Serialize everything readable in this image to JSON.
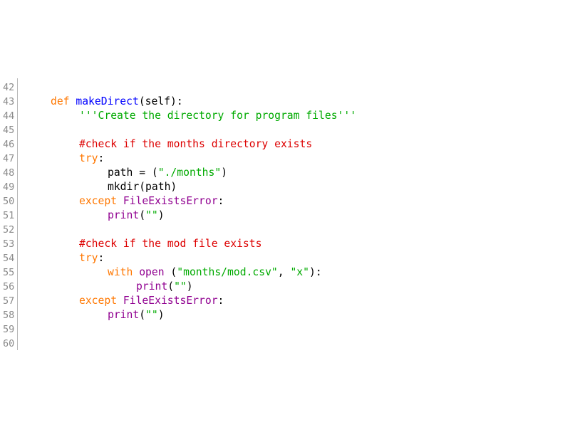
{
  "colors": {
    "keyword": "#ff7700",
    "definition": "#0000ff",
    "string": "#00aa00",
    "comment": "#dd0000",
    "builtin": "#900090",
    "plain": "#000000",
    "line_number": "#8a8a8a"
  },
  "lines": [
    {
      "n": "42",
      "indent": 0,
      "tokens": []
    },
    {
      "n": "43",
      "indent": 0,
      "tokens": [
        {
          "t": "def",
          "c": "keyword"
        },
        {
          "t": " ",
          "c": "plain"
        },
        {
          "t": "makeDirect",
          "c": "definition"
        },
        {
          "t": "(self):",
          "c": "plain"
        }
      ]
    },
    {
      "n": "44",
      "indent": 1,
      "tokens": [
        {
          "t": "'''Create the directory for program files'''",
          "c": "string"
        }
      ]
    },
    {
      "n": "45",
      "indent": 0,
      "tokens": []
    },
    {
      "n": "46",
      "indent": 1,
      "tokens": [
        {
          "t": "#check if the months directory exists",
          "c": "comment"
        }
      ]
    },
    {
      "n": "47",
      "indent": 1,
      "tokens": [
        {
          "t": "try",
          "c": "keyword"
        },
        {
          "t": ":",
          "c": "plain"
        }
      ]
    },
    {
      "n": "48",
      "indent": 2,
      "tokens": [
        {
          "t": "path = (",
          "c": "plain"
        },
        {
          "t": "\"./months\"",
          "c": "string"
        },
        {
          "t": ")",
          "c": "plain"
        }
      ]
    },
    {
      "n": "49",
      "indent": 2,
      "tokens": [
        {
          "t": "mkdir(path)",
          "c": "plain"
        }
      ]
    },
    {
      "n": "50",
      "indent": 1,
      "tokens": [
        {
          "t": "except",
          "c": "keyword"
        },
        {
          "t": " ",
          "c": "plain"
        },
        {
          "t": "FileExistsError",
          "c": "builtin"
        },
        {
          "t": ":",
          "c": "plain"
        }
      ]
    },
    {
      "n": "51",
      "indent": 2,
      "tokens": [
        {
          "t": "print",
          "c": "builtin"
        },
        {
          "t": "(",
          "c": "plain"
        },
        {
          "t": "\"\"",
          "c": "string"
        },
        {
          "t": ")",
          "c": "plain"
        }
      ]
    },
    {
      "n": "52",
      "indent": 0,
      "tokens": []
    },
    {
      "n": "53",
      "indent": 1,
      "tokens": [
        {
          "t": "#check if the mod file exists",
          "c": "comment"
        }
      ]
    },
    {
      "n": "54",
      "indent": 1,
      "tokens": [
        {
          "t": "try",
          "c": "keyword"
        },
        {
          "t": ":",
          "c": "plain"
        }
      ]
    },
    {
      "n": "55",
      "indent": 2,
      "tokens": [
        {
          "t": "with",
          "c": "keyword"
        },
        {
          "t": " ",
          "c": "plain"
        },
        {
          "t": "open",
          "c": "builtin"
        },
        {
          "t": " (",
          "c": "plain"
        },
        {
          "t": "\"months/mod.csv\"",
          "c": "string"
        },
        {
          "t": ", ",
          "c": "plain"
        },
        {
          "t": "\"x\"",
          "c": "string"
        },
        {
          "t": "):",
          "c": "plain"
        }
      ]
    },
    {
      "n": "56",
      "indent": 3,
      "tokens": [
        {
          "t": "print",
          "c": "builtin"
        },
        {
          "t": "(",
          "c": "plain"
        },
        {
          "t": "\"\"",
          "c": "string"
        },
        {
          "t": ")",
          "c": "plain"
        }
      ]
    },
    {
      "n": "57",
      "indent": 1,
      "tokens": [
        {
          "t": "except",
          "c": "keyword"
        },
        {
          "t": " ",
          "c": "plain"
        },
        {
          "t": "FileExistsError",
          "c": "builtin"
        },
        {
          "t": ":",
          "c": "plain"
        }
      ]
    },
    {
      "n": "58",
      "indent": 2,
      "tokens": [
        {
          "t": "print",
          "c": "builtin"
        },
        {
          "t": "(",
          "c": "plain"
        },
        {
          "t": "\"\"",
          "c": "string"
        },
        {
          "t": ")",
          "c": "plain"
        }
      ]
    },
    {
      "n": "59",
      "indent": 0,
      "tokens": []
    },
    {
      "n": "60",
      "indent": 0,
      "tokens": []
    }
  ]
}
